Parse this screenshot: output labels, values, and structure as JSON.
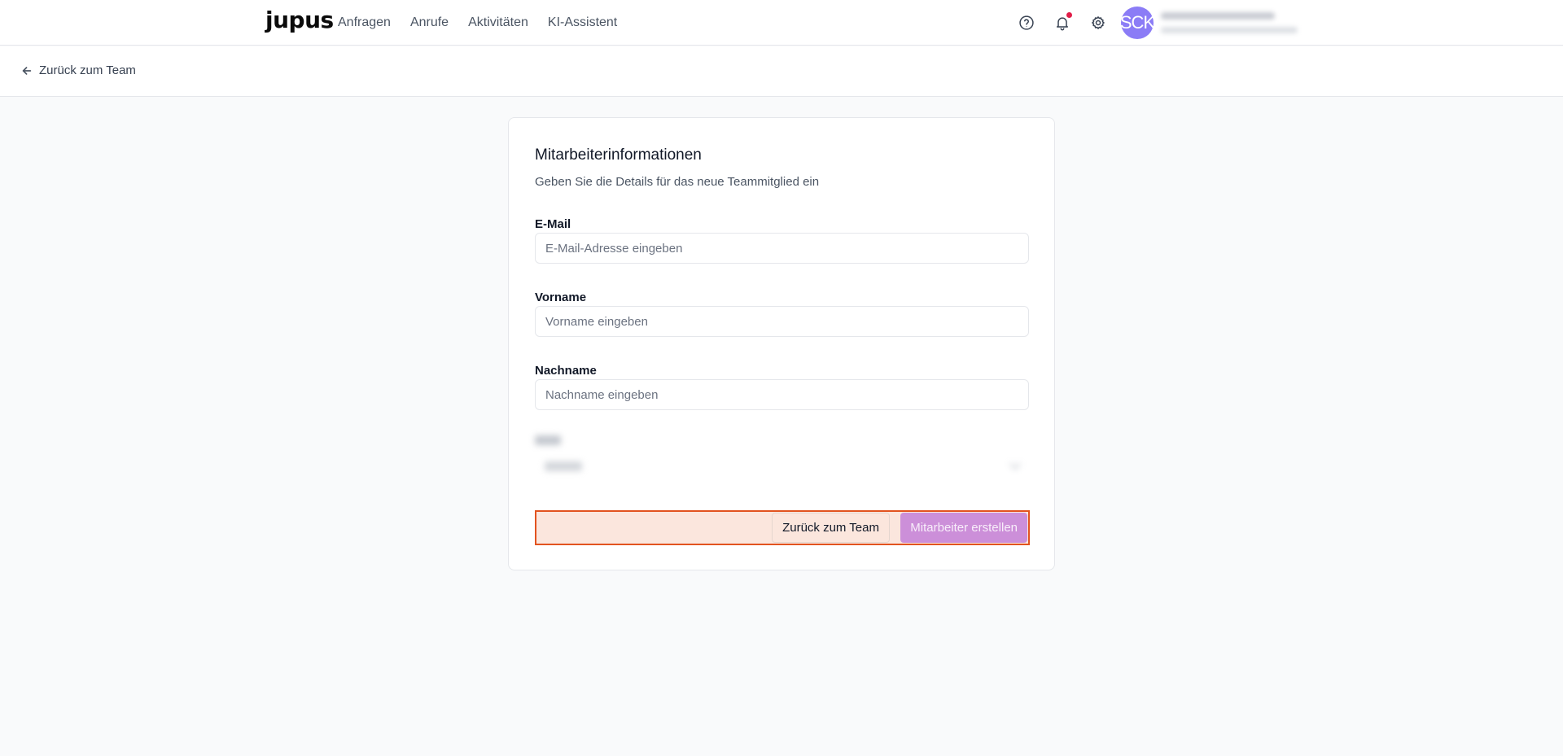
{
  "header": {
    "logo": "jupus",
    "nav": [
      "Anfragen",
      "Anrufe",
      "Aktivitäten",
      "KI-Assistent"
    ],
    "avatar_initials": "SCK",
    "icons": [
      "help-circle-icon",
      "bell-icon",
      "gear-icon"
    ],
    "notification_dot_color": "#e11d48"
  },
  "subheader": {
    "back_label": "Zurück zum Team"
  },
  "form": {
    "title": "Mitarbeiterinformationen",
    "subtitle": "Geben Sie die Details für das neue Teammitglied ein",
    "email": {
      "label": "E-Mail",
      "placeholder": "E-Mail-Adresse eingeben",
      "value": ""
    },
    "firstname": {
      "label": "Vorname",
      "placeholder": "Vorname eingeben",
      "value": ""
    },
    "lastname": {
      "label": "Nachname",
      "placeholder": "Nachname eingeben",
      "value": ""
    },
    "cancel_label": "Zurück zum Team",
    "submit_label": "Mitarbeiter erstellen"
  },
  "colors": {
    "accent": "#cc8fd9",
    "avatar": "#8b7cf6",
    "highlight_border": "#e2531f",
    "highlight_fill": "#fbe6dd"
  }
}
